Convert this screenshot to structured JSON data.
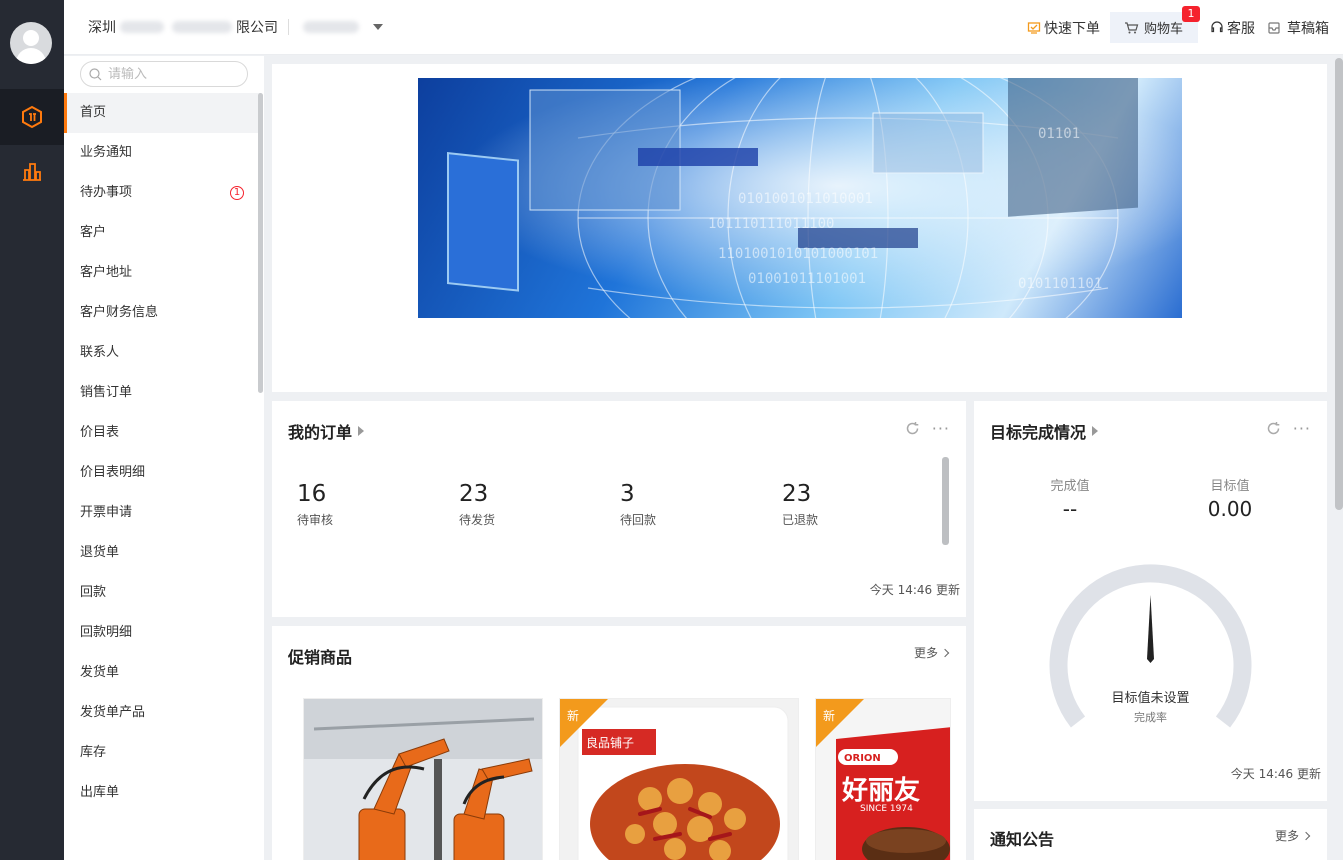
{
  "header": {
    "company_prefix": "深圳",
    "company_suffix": "限公司",
    "quick_order": "快速下单",
    "cart_label": "购物车",
    "cart_count": "1",
    "service": "客服",
    "drafts": "草稿箱"
  },
  "search": {
    "placeholder": "请输入"
  },
  "menu": {
    "items": [
      "首页",
      "业务通知",
      "待办事项",
      "客户",
      "客户地址",
      "客户财务信息",
      "联系人",
      "销售订单",
      "价目表",
      "价目表明细",
      "开票申请",
      "退货单",
      "回款",
      "回款明细",
      "发货单",
      "发货单产品",
      "库存",
      "出库单"
    ],
    "todo_badge": "1"
  },
  "orders": {
    "title": "我的订单",
    "stats": [
      {
        "value": "16",
        "label": "待审核"
      },
      {
        "value": "23",
        "label": "待发货"
      },
      {
        "value": "3",
        "label": "待回款"
      },
      {
        "value": "23",
        "label": "已退款"
      }
    ],
    "updated": "今天 14:46 更新"
  },
  "goal": {
    "title": "目标完成情况",
    "done_label": "完成值",
    "done_value": "--",
    "target_label": "目标值",
    "target_value": "0.00",
    "gauge_text": "目标值未设置",
    "gauge_sub": "完成率",
    "updated": "今天 14:46 更新"
  },
  "promo": {
    "title": "促销商品",
    "more": "更多",
    "new_tag": "新",
    "product2_brand": "良品铺子",
    "product3_brand": "ORION",
    "product3_name": "好丽友",
    "product3_since": "SINCE 1974"
  },
  "notice": {
    "title": "通知公告",
    "more": "更多"
  },
  "colors": {
    "accent": "#ff7a0e",
    "rail": "#262a33",
    "badge": "#f5222d",
    "new_tag": "#f39a1c"
  }
}
